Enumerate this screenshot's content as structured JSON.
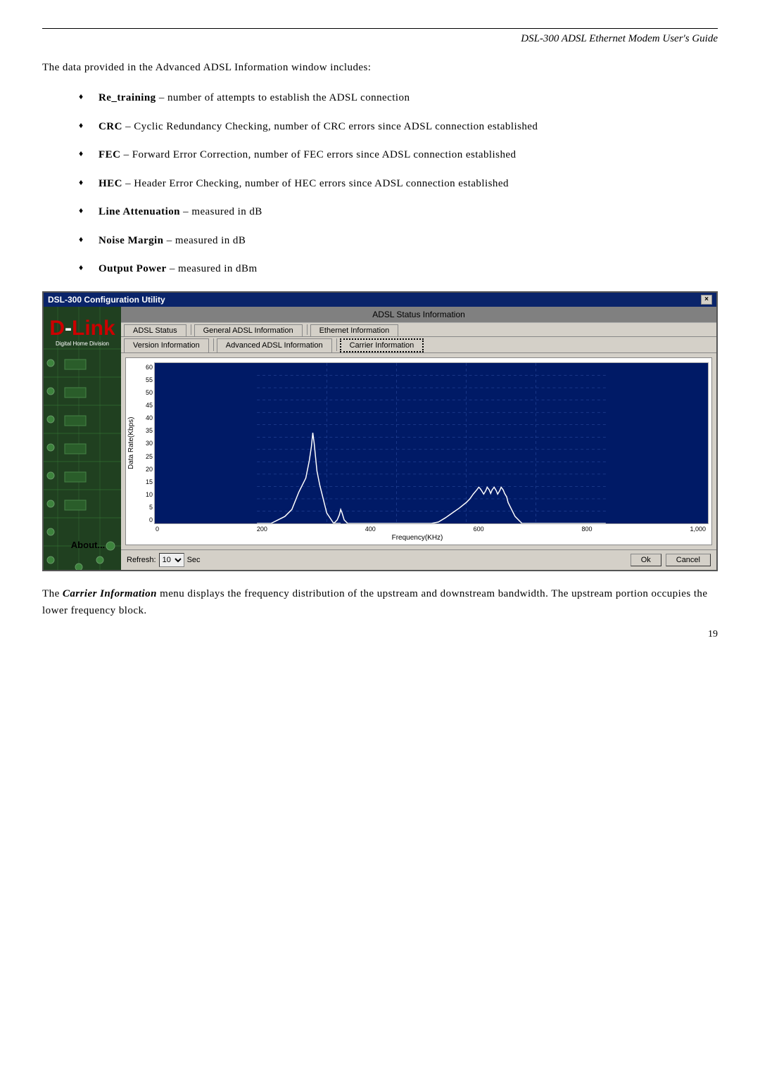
{
  "header": {
    "title": "DSL-300 ADSL Ethernet Modem User's Guide"
  },
  "intro_text": "The data provided in the Advanced ADSL Information window includes:",
  "bullets": [
    {
      "term": "Re_training",
      "desc": "– number of attempts to establish the ADSL connection"
    },
    {
      "term": "CRC",
      "desc": "– Cyclic Redundancy Checking, number of CRC errors since ADSL connection established"
    },
    {
      "term": "FEC",
      "desc": "– Forward Error Correction, number of FEC errors since ADSL connection established"
    },
    {
      "term": "HEC",
      "desc": "– Header Error Checking, number of HEC errors since ADSL connection established"
    },
    {
      "term": "Line Attenuation",
      "desc": "– measured in dB"
    },
    {
      "term": "Noise Margin",
      "desc": "– measured in dB"
    },
    {
      "term": "Output Power",
      "desc": "– measured in dBm"
    }
  ],
  "window": {
    "title": "DSL-300 Configuration Utility",
    "close_btn": "×",
    "adsl_status_bar": "ADSL Status Information",
    "tabs_row1": [
      {
        "label": "ADSL Status",
        "active": false
      },
      {
        "label": "General ADSL Information",
        "active": false
      },
      {
        "label": "Ethernet Information",
        "active": false
      }
    ],
    "tabs_row2": [
      {
        "label": "Version Information",
        "active": false
      },
      {
        "label": "Advanced ADSL Information",
        "active": false
      },
      {
        "label": "Carrier Information",
        "active": true,
        "dotted": true
      }
    ],
    "chart": {
      "y_axis_label": "Data Rate(Kbps)",
      "y_values": [
        "60",
        "55",
        "50",
        "45",
        "40",
        "35",
        "30",
        "25",
        "20",
        "15",
        "10",
        "5",
        "0"
      ],
      "x_values": [
        "0",
        "200",
        "400",
        "600",
        "800",
        "1,000"
      ],
      "x_label": "Frequency(KHz)"
    },
    "sidebar": {
      "logo_d": "D",
      "logo_dash": "-",
      "logo_link": "Link",
      "subtitle": "Digital Home Division",
      "about": "About..."
    },
    "bottom": {
      "refresh_label": "Refresh:",
      "refresh_value": "10",
      "sec_label": "Sec",
      "ok_btn": "Ok",
      "cancel_btn": "Cancel"
    }
  },
  "footer_text_before_em": "The ",
  "footer_em": "Carrier Information",
  "footer_text_after_em": " menu displays the frequency distribution of the upstream and downstream bandwidth. The upstream portion occupies the lower frequency block.",
  "page_number": "19"
}
